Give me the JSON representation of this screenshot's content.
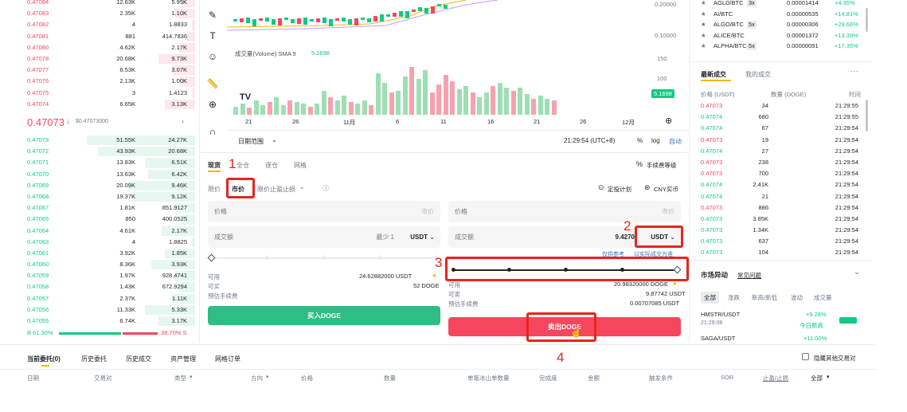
{
  "orderbook": {
    "asks": [
      {
        "price": "0.47084",
        "qty": "12.63K",
        "total": "5.95K"
      },
      {
        "price": "0.47083",
        "qty": "2.35K",
        "total": "1.10K"
      },
      {
        "price": "0.47082",
        "qty": "4",
        "total": "1.8833"
      },
      {
        "price": "0.47081",
        "qty": "881",
        "total": "414.7836"
      },
      {
        "price": "0.47080",
        "qty": "4.62K",
        "total": "2.17K"
      },
      {
        "price": "0.47078",
        "qty": "20.68K",
        "total": "9.73K"
      },
      {
        "price": "0.47077",
        "qty": "6.53K",
        "total": "3.07K"
      },
      {
        "price": "0.47076",
        "qty": "2.13K",
        "total": "1.00K"
      },
      {
        "price": "0.47075",
        "qty": "3",
        "total": "1.4123"
      },
      {
        "price": "0.47074",
        "qty": "6.65K",
        "total": "3.13K"
      }
    ],
    "last_price": "0.47073",
    "last_price_sub": "$0.47073000",
    "bids": [
      {
        "price": "0.47073",
        "qty": "51.55K",
        "total": "24.27K"
      },
      {
        "price": "0.47072",
        "qty": "43.93K",
        "total": "20.68K"
      },
      {
        "price": "0.47071",
        "qty": "13.83K",
        "total": "6.51K"
      },
      {
        "price": "0.47070",
        "qty": "13.63K",
        "total": "6.42K"
      },
      {
        "price": "0.47069",
        "qty": "20.09K",
        "total": "9.46K"
      },
      {
        "price": "0.47068",
        "qty": "19.37K",
        "total": "9.12K"
      },
      {
        "price": "0.47067",
        "qty": "1.81K",
        "total": "851.9127"
      },
      {
        "price": "0.47065",
        "qty": "850",
        "total": "400.0525"
      },
      {
        "price": "0.47064",
        "qty": "4.61K",
        "total": "2.17K"
      },
      {
        "price": "0.47063",
        "qty": "4",
        "total": "1.8825"
      },
      {
        "price": "0.47061",
        "qty": "3.92K",
        "total": "1.85K"
      },
      {
        "price": "0.47060",
        "qty": "8.36K",
        "total": "3.93K"
      },
      {
        "price": "0.47059",
        "qty": "1.97K",
        "total": "928.4741"
      },
      {
        "price": "0.47058",
        "qty": "1.43K",
        "total": "672.9294"
      },
      {
        "price": "0.47057",
        "qty": "2.37K",
        "total": "1.11K"
      },
      {
        "price": "0.47056",
        "qty": "11.33K",
        "total": "5.33K"
      },
      {
        "price": "0.47055",
        "qty": "6.74K",
        "total": "3.17K"
      }
    ],
    "buy_ratio": "B 61.30%",
    "sell_ratio": "38.70% S"
  },
  "chart": {
    "price_ticks": [
      "0.20000",
      "0.10000"
    ],
    "volume_label": "成交量(Volume) SMA 9",
    "volume_sma_value": "5.1698",
    "volume_ticks": [
      "150",
      "100",
      "50"
    ],
    "volume_badge": "5.1698",
    "x_ticks": [
      "21",
      "26",
      "11月",
      "6",
      "11",
      "16",
      "21",
      "26",
      "12月"
    ],
    "date_range": "日期范围",
    "time_label": "21:29:54 (UTC+8)",
    "pct_label": "%",
    "log_label": "log",
    "auto_label": "自动",
    "logo": "TV"
  },
  "trade_panel": {
    "tabs": [
      "现货",
      "全仓",
      "逐仓",
      "网格"
    ],
    "fee_label": "手续费等级",
    "order_types": [
      "限价",
      "市价",
      "限价止盈止损"
    ],
    "plan_label": "定投计划",
    "currency_label": "CNY买币",
    "buy": {
      "price_placeholder": "价格",
      "price_hint": "市价",
      "amount_placeholder": "成交额",
      "min_hint": "最少 1",
      "unit": "USDT",
      "available_label": "可用",
      "available_value": "24.62882000 USDT",
      "can_buy_label": "可买",
      "can_buy_value": "52 DOGE",
      "fee_est_label": "预估手续费",
      "button": "买入DOGE"
    },
    "sell": {
      "price_placeholder": "价格",
      "price_hint": "市价",
      "amount_placeholder": "成交额",
      "amount_value": "9.4270",
      "unit": "USDT",
      "hint_a": "仅供参考",
      "hint_b": "以实际成交为准",
      "available_label": "可用",
      "available_value": "20.98320000 DOGE",
      "can_sell_label": "可卖",
      "can_sell_value": "9.87742 USDT",
      "fee_est_label": "预估手续费",
      "fee_est_value": "0.00707085 USDT",
      "button": "卖出DOGE"
    }
  },
  "annotations": [
    "1",
    "2",
    "3",
    "4"
  ],
  "right_panel": {
    "pairs": [
      {
        "name": "AGLD/BTC",
        "lev": "3x",
        "price": "0.00001414",
        "change": "+4.35%"
      },
      {
        "name": "AI/BTC",
        "lev": "",
        "price": "0.00000535",
        "change": "+14.81%"
      },
      {
        "name": "ALGO/BTC",
        "lev": "5x",
        "price": "0.00000306",
        "change": "+29.66%"
      },
      {
        "name": "ALICE/BTC",
        "lev": "",
        "price": "0.00001372",
        "change": "+13.39%"
      },
      {
        "name": "ALPHA/BTC",
        "lev": "5x",
        "price": "0.00000091",
        "change": "+17.35%"
      }
    ],
    "trades_tabs": [
      "最新成交",
      "我的成交"
    ],
    "trades_headers": [
      "价格 (USDT)",
      "数量 (DOGE)",
      "时间"
    ],
    "trades": [
      {
        "price": "0.47073",
        "qty": "34",
        "time": "21:29:55",
        "side": "sell"
      },
      {
        "price": "0.47074",
        "qty": "680",
        "time": "21:29:55",
        "side": "buy"
      },
      {
        "price": "0.47074",
        "qty": "67",
        "time": "21:29:54",
        "side": "buy"
      },
      {
        "price": "0.47073",
        "qty": "19",
        "time": "21:29:54",
        "side": "sell"
      },
      {
        "price": "0.47074",
        "qty": "27",
        "time": "21:29:54",
        "side": "buy"
      },
      {
        "price": "0.47073",
        "qty": "238",
        "time": "21:29:54",
        "side": "sell"
      },
      {
        "price": "0.47073",
        "qty": "700",
        "time": "21:29:54",
        "side": "sell"
      },
      {
        "price": "0.47074",
        "qty": "2.41K",
        "time": "21:29:54",
        "side": "buy"
      },
      {
        "price": "0.47074",
        "qty": "21",
        "time": "21:29:54",
        "side": "buy"
      },
      {
        "price": "0.47073",
        "qty": "886",
        "time": "21:29:54",
        "side": "sell"
      },
      {
        "price": "0.47073",
        "qty": "3.85K",
        "time": "21:29:54",
        "side": "buy"
      },
      {
        "price": "0.47073",
        "qty": "1.34K",
        "time": "21:29:54",
        "side": "buy"
      },
      {
        "price": "0.47073",
        "qty": "637",
        "time": "21:29:54",
        "side": "buy"
      },
      {
        "price": "0.47073",
        "qty": "104",
        "time": "21:29:54",
        "side": "buy"
      }
    ],
    "market_title": "市场异动",
    "market_link": "常见问题",
    "market_tabs": [
      "全部",
      "涨跌",
      "新高/新低",
      "波动",
      "成交量"
    ],
    "market_items": [
      {
        "name": "HMSTR/USDT",
        "time": "21:29:08",
        "change": "+9.28%",
        "note": "今日新高"
      },
      {
        "name": "SAGA/USDT",
        "time": "",
        "change": "+11.00%",
        "note": ""
      }
    ]
  },
  "bottom": {
    "tabs": [
      "当前委托(0)",
      "历史委托",
      "历史成交",
      "资产管理",
      "网格订单"
    ],
    "hide_others": "隐藏其他交易对",
    "headers": [
      "日期",
      "交易对",
      "类型",
      "方向",
      "价格",
      "数量",
      "单笔冰山单数量",
      "完成度",
      "金额",
      "触发条件",
      "SOR",
      "止盈/止损",
      "全部"
    ]
  }
}
